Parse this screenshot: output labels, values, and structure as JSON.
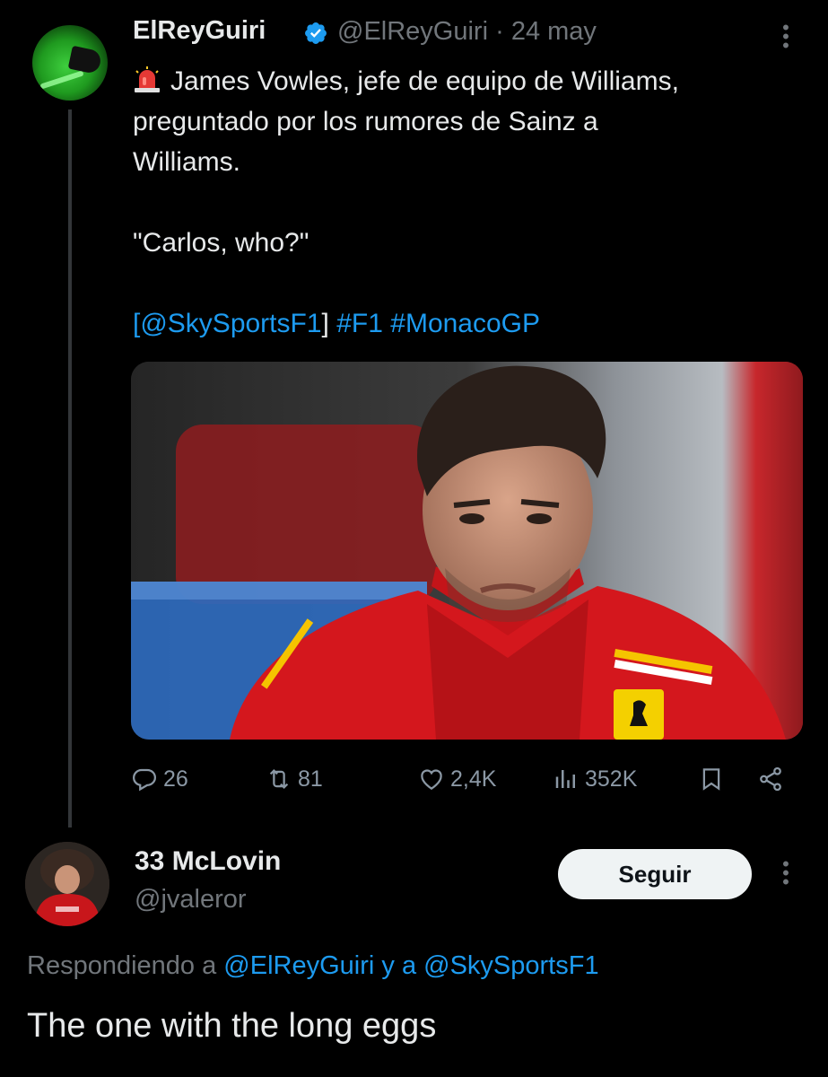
{
  "tweet": {
    "display_name": "ElReyGuiri",
    "handle": "@ElReyGuiri",
    "separator": "·",
    "date": "24 may",
    "line1": "James Vowles, jefe de equipo de Williams,",
    "line2": "preguntado por los rumores de Sainz a",
    "line3": "Williams.",
    "quote": "\"Carlos, who?\"",
    "bracket_open": "[",
    "mention": "@SkySportsF1",
    "bracket_close": "]",
    "hashtag1": "#F1",
    "hashtag2": "#MonacoGP",
    "stats": {
      "replies": "26",
      "retweets": "81",
      "likes": "2,4K",
      "views": "352K"
    }
  },
  "reply": {
    "display_name": "33 McLovin",
    "handle": "@jvaleror",
    "follow_label": "Seguir",
    "replying_prefix": "Respondiendo a",
    "replying_user1": "@ElReyGuiri",
    "replying_join": "y a",
    "replying_user2": "@SkySportsF1",
    "text": "The one with the long eggs"
  },
  "colors": {
    "background": "#000000",
    "text": "#e7e9ea",
    "muted": "#71767b",
    "link": "#1d9bf0",
    "verified": "#1d9bf0",
    "follow_bg": "#eff3f4"
  },
  "icons": [
    "siren-emoji-icon",
    "verified-badge-icon",
    "more-options-icon",
    "reply-icon",
    "retweet-icon",
    "like-icon",
    "views-icon",
    "bookmark-icon",
    "share-icon"
  ]
}
